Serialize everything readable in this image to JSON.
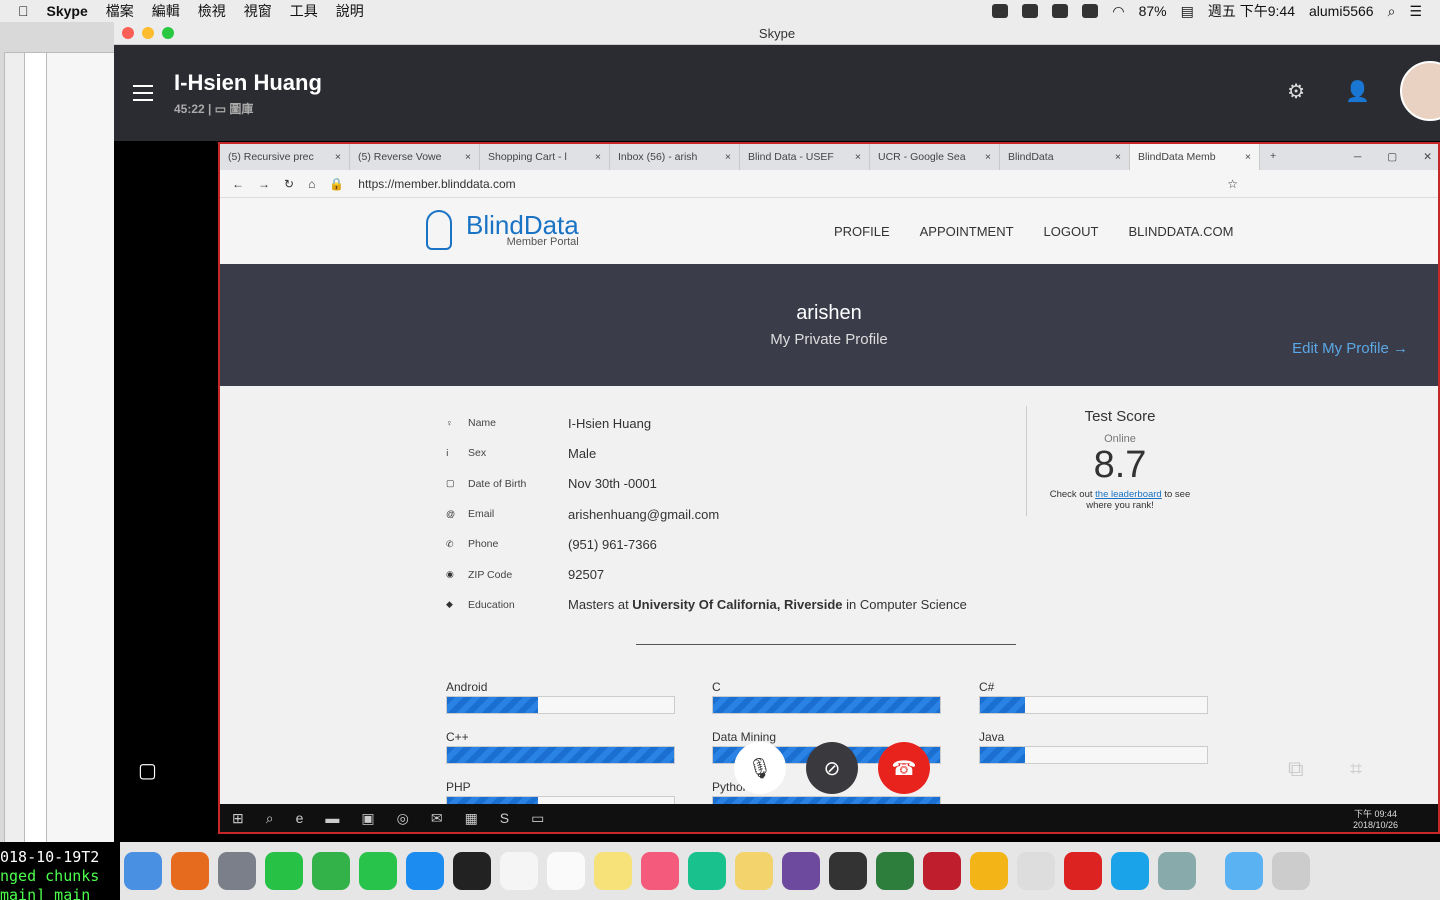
{
  "menubar": {
    "app": "Skype",
    "items": [
      "檔案",
      "編輯",
      "檢視",
      "視窗",
      "工具",
      "說明"
    ],
    "battery": "87%",
    "datetime": "週五 下午9:44",
    "user": "alumi5566"
  },
  "terminal": {
    "lines": [
      "018-10-19T2",
      "nged chunks",
      "main] main"
    ]
  },
  "skype": {
    "window_title": "Skype",
    "contact": "I-Hsien Huang",
    "duration": "45:22",
    "sub_label": "圖庫"
  },
  "browser": {
    "tabs": [
      {
        "label": "(5) Recursive prec"
      },
      {
        "label": "(5) Reverse Vowe"
      },
      {
        "label": "Shopping Cart - l"
      },
      {
        "label": "Inbox (56) - arish"
      },
      {
        "label": "Blind Data - USEF"
      },
      {
        "label": "UCR - Google Sea"
      },
      {
        "label": "BlindData"
      },
      {
        "label": "BlindData Memb"
      }
    ],
    "url": "https://member.blinddata.com"
  },
  "site": {
    "logo": "BlindData",
    "logo_sub": "Member Portal",
    "nav": [
      "PROFILE",
      "APPOINTMENT",
      "LOGOUT",
      "BLINDDATA.COM"
    ],
    "username": "arishen",
    "subtitle": "My Private Profile",
    "edit": "Edit My Profile →",
    "fields": [
      {
        "icon": "person-icon",
        "glyph": "♀",
        "k": "Name",
        "v": "I-Hsien Huang"
      },
      {
        "icon": "sex-icon",
        "glyph": "ⅰ",
        "k": "Sex",
        "v": "Male"
      },
      {
        "icon": "calendar-icon",
        "glyph": "▢",
        "k": "Date of Birth",
        "v": "Nov 30th -0001"
      },
      {
        "icon": "at-icon",
        "glyph": "@",
        "k": "Email",
        "v": "arishenhuang@gmail.com"
      },
      {
        "icon": "phone-icon",
        "glyph": "✆",
        "k": "Phone",
        "v": "(951) 961-7366"
      },
      {
        "icon": "globe-icon",
        "glyph": "◉",
        "k": "ZIP Code",
        "v": "92507"
      }
    ],
    "education": {
      "k": "Education",
      "pre": "Masters at ",
      "school": "University Of California, Riverside",
      "post": " in Computer Science"
    },
    "score": {
      "title": "Test Score",
      "label": "Online",
      "value": "8.7",
      "pre": "Check out ",
      "link": "the leaderboard",
      "post": " to see where you rank!"
    },
    "skills": [
      {
        "name": "Android",
        "level": 0.4
      },
      {
        "name": "C",
        "level": 1.0
      },
      {
        "name": "C#",
        "level": 0.2
      },
      {
        "name": "C++",
        "level": 1.0
      },
      {
        "name": "Data Mining",
        "level": 1.0
      },
      {
        "name": "Java",
        "level": 0.2
      },
      {
        "name": "PHP",
        "level": 0.4
      },
      {
        "name": "Python",
        "level": 1.0
      }
    ]
  },
  "taskbar": {
    "time": "下午 09:44",
    "date": "2018/10/26"
  }
}
